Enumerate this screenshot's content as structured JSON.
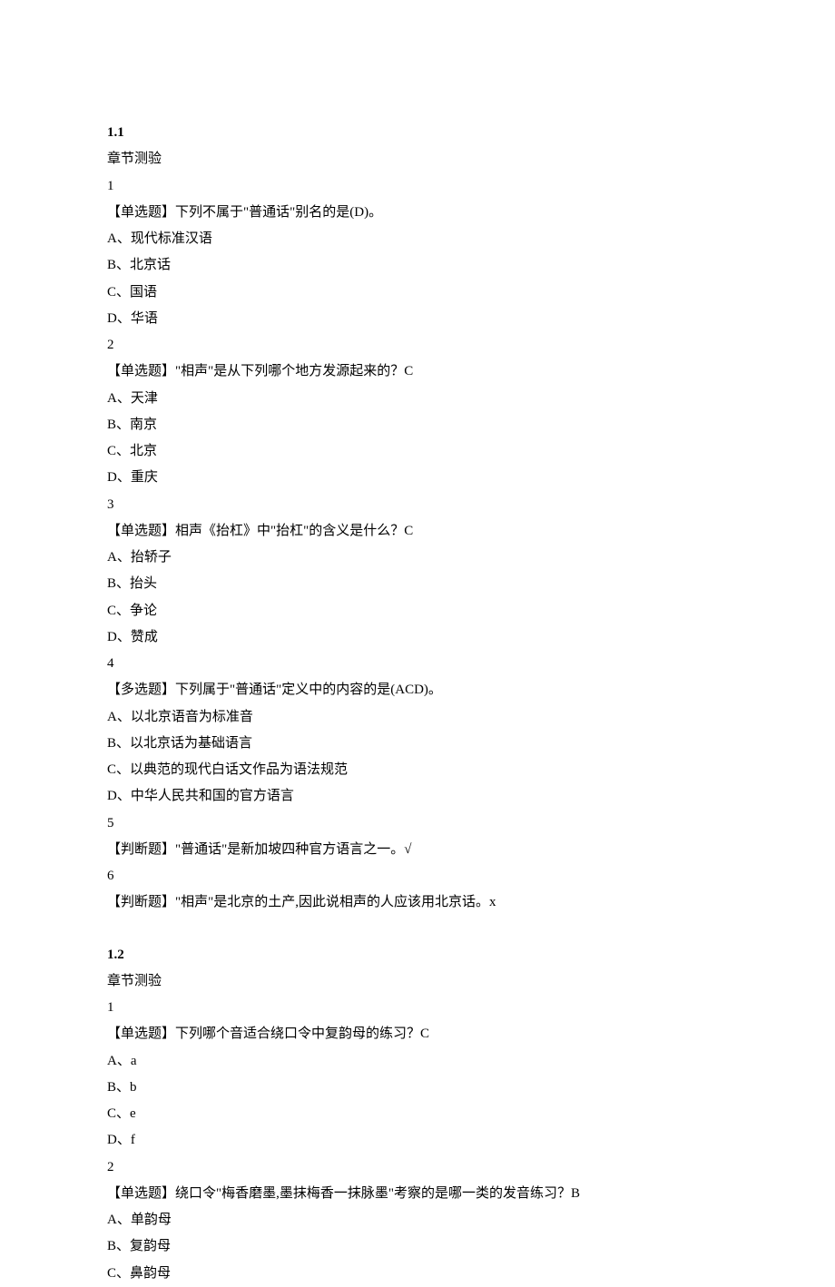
{
  "sections": [
    {
      "heading": "1.1",
      "subheading": "章节测验",
      "questions": [
        {
          "num": "1",
          "prompt": "【单选题】下列不属于\"普通话\"别名的是(D)。",
          "options": [
            "A、现代标准汉语",
            "B、北京话",
            "C、国语",
            "D、华语"
          ]
        },
        {
          "num": "2",
          "prompt": "【单选题】\"相声\"是从下列哪个地方发源起来的？C",
          "options": [
            "A、天津",
            "B、南京",
            "C、北京",
            "D、重庆"
          ]
        },
        {
          "num": "3",
          "prompt": "【单选题】相声《抬杠》中\"抬杠\"的含义是什么？C",
          "options": [
            "A、抬轿子",
            "B、抬头",
            "C、争论",
            "D、赞成"
          ]
        },
        {
          "num": "4",
          "prompt": "【多选题】下列属于\"普通话\"定义中的内容的是(ACD)。",
          "options": [
            "A、以北京语音为标准音",
            "B、以北京话为基础语言",
            "C、以典范的现代白话文作品为语法规范",
            "D、中华人民共和国的官方语言"
          ]
        },
        {
          "num": "5",
          "prompt": "【判断题】\"普通话\"是新加坡四种官方语言之一。√",
          "options": []
        },
        {
          "num": "6",
          "prompt": "【判断题】\"相声\"是北京的土产,因此说相声的人应该用北京话。x",
          "options": []
        }
      ]
    },
    {
      "heading": "1.2",
      "subheading": "章节测验",
      "questions": [
        {
          "num": "1",
          "prompt": "【单选题】下列哪个音适合绕口令中复韵母的练习？C",
          "options": [
            "A、a",
            "B、b",
            "C、e",
            "D、f"
          ]
        },
        {
          "num": "2",
          "prompt": "【单选题】绕口令\"梅香磨墨,墨抹梅香一抹脉墨\"考察的是哪一类的发音练习？B",
          "options": [
            "A、单韵母",
            "B、复韵母",
            "C、鼻韵母"
          ]
        }
      ]
    }
  ]
}
